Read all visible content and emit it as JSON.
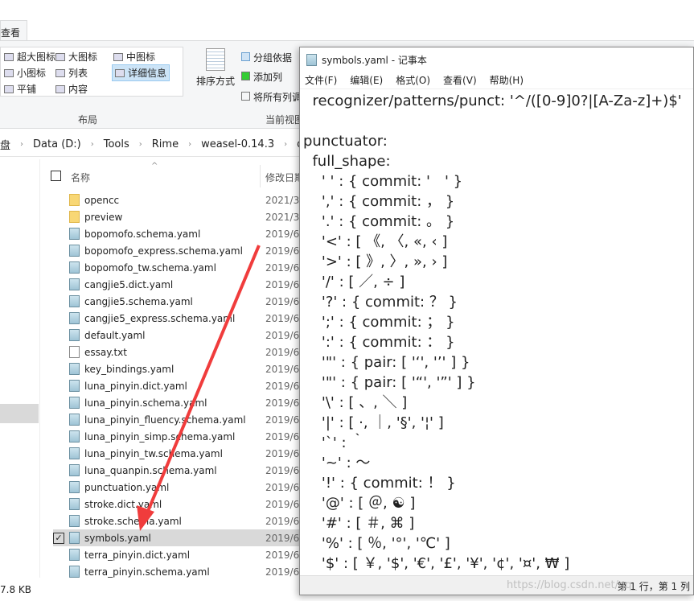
{
  "explorer": {
    "tab": "查看",
    "layout": {
      "items": [
        "超大图标",
        "大图标",
        "中图标",
        "小图标",
        "列表",
        "详细信息",
        "平铺",
        "内容"
      ],
      "selected": "详细信息",
      "group_label": "布局"
    },
    "view": {
      "sort_label": "排序方式",
      "group_by": "分组依据",
      "add_column": "添加列",
      "fit_columns": "将所有列调",
      "group_label": "当前视图"
    },
    "breadcrumb": [
      "盘",
      "Data (D:)",
      "Tools",
      "Rime",
      "weasel-0.14.3",
      "data"
    ],
    "columns": {
      "name": "名称",
      "date": "修改日期"
    },
    "files": [
      {
        "name": "opencc",
        "date": "2021/3/",
        "type": "folder"
      },
      {
        "name": "preview",
        "date": "2021/3/",
        "type": "folder"
      },
      {
        "name": "bopomofo.schema.yaml",
        "date": "2019/6/",
        "type": "yaml"
      },
      {
        "name": "bopomofo_express.schema.yaml",
        "date": "2019/6/",
        "type": "yaml"
      },
      {
        "name": "bopomofo_tw.schema.yaml",
        "date": "2019/6/",
        "type": "yaml"
      },
      {
        "name": "cangjie5.dict.yaml",
        "date": "2019/6/",
        "type": "yaml"
      },
      {
        "name": "cangjie5.schema.yaml",
        "date": "2019/6/",
        "type": "yaml"
      },
      {
        "name": "cangjie5_express.schema.yaml",
        "date": "2019/6/",
        "type": "yaml"
      },
      {
        "name": "default.yaml",
        "date": "2019/6/",
        "type": "yaml"
      },
      {
        "name": "essay.txt",
        "date": "2019/6/",
        "type": "txt"
      },
      {
        "name": "key_bindings.yaml",
        "date": "2019/6/",
        "type": "yaml"
      },
      {
        "name": "luna_pinyin.dict.yaml",
        "date": "2019/6/",
        "type": "yaml"
      },
      {
        "name": "luna_pinyin.schema.yaml",
        "date": "2019/6/",
        "type": "yaml"
      },
      {
        "name": "luna_pinyin_fluency.schema.yaml",
        "date": "2019/6/",
        "type": "yaml"
      },
      {
        "name": "luna_pinyin_simp.schema.yaml",
        "date": "2019/6/",
        "type": "yaml"
      },
      {
        "name": "luna_pinyin_tw.schema.yaml",
        "date": "2019/6/",
        "type": "yaml"
      },
      {
        "name": "luna_quanpin.schema.yaml",
        "date": "2019/6/",
        "type": "yaml"
      },
      {
        "name": "punctuation.yaml",
        "date": "2019/6/",
        "type": "yaml"
      },
      {
        "name": "stroke.dict.yaml",
        "date": "2019/6/",
        "type": "yaml"
      },
      {
        "name": "stroke.schema.yaml",
        "date": "2019/6/",
        "type": "yaml"
      },
      {
        "name": "symbols.yaml",
        "date": "2019/6/",
        "type": "yaml",
        "selected": true
      },
      {
        "name": "terra_pinyin.dict.yaml",
        "date": "2019/6/",
        "type": "yaml"
      },
      {
        "name": "terra_pinyin.schema.yaml",
        "date": "2019/6/",
        "type": "yaml"
      }
    ],
    "status_size": "7.8 KB"
  },
  "notepad": {
    "title": "symbols.yaml - 记事本",
    "menu": [
      "文件(F)",
      "编辑(E)",
      "格式(O)",
      "查看(V)",
      "帮助(H)"
    ],
    "lines": [
      "  recognizer/patterns/punct: '^/([0-9]0?|[A-Za-z]+)$'",
      "",
      "punctuator:",
      "  full_shape:",
      "    ' ' : { commit: '　' }",
      "    ',' : { commit: ， }",
      "    '.' : { commit: 。 }",
      "    '<' : [ 《, 〈, «, ‹ ]",
      "    '>' : [ 》, 〉, », › ]",
      "    '/' : [ ／, ÷ ]",
      "    '?' : { commit: ？ }",
      "    ';' : { commit: ； }",
      "    ':' : { commit: ： }",
      "    '\"' : { pair: [ '‘', '’' ] }",
      "    '\"' : { pair: [ '“', '”' ] }",
      "    '\\' : [ 、, ＼ ]",
      "    '|' : [ ·, ｜, '§', '¦' ]",
      "    '`' : ｀",
      "    '~' : ～",
      "    '!' : { commit: ！ }",
      "    '@' : [ ＠, ☯ ]",
      "    '#' : [ ＃, ⌘ ]",
      "    '%' : [ ％, '°', '℃' ]",
      "    '$' : [ ￥, '$', '€', '£', '¥', '¢', '¤', ₩ ]"
    ],
    "status": "第 1 行，第 1 列",
    "watermark": "https://blog.csdn.net/qq_"
  },
  "colors": {
    "selection": "#d9d9d9",
    "accent": "#cce4f7",
    "arrow": "#f03c3c"
  }
}
